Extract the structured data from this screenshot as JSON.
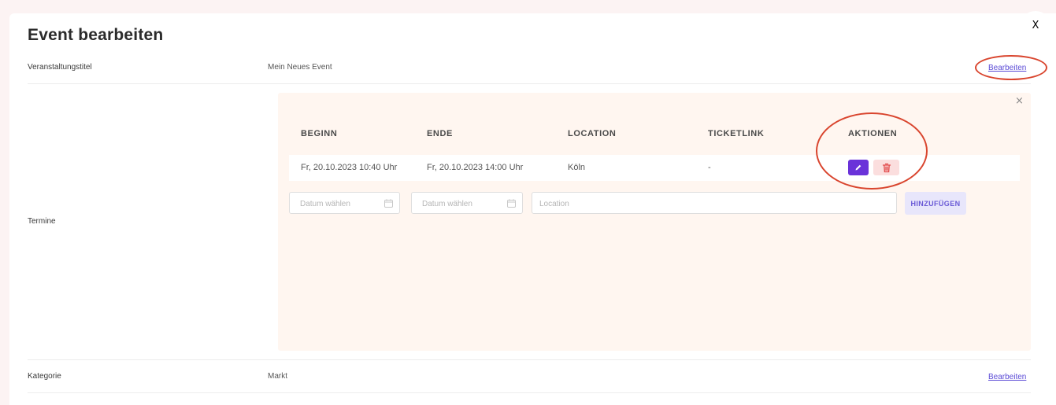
{
  "modal": {
    "title": "Event bearbeiten",
    "close_label": "X"
  },
  "fields": {
    "title": {
      "label": "Veranstaltungstitel",
      "value": "Mein Neues Event",
      "edit_label": "Bearbeiten"
    },
    "dates": {
      "label": "Termine"
    },
    "category": {
      "label": "Kategorie",
      "value": "Markt",
      "edit_label": "Bearbeiten"
    }
  },
  "dates_table": {
    "close_label": "×",
    "columns": [
      "BEGINN",
      "ENDE",
      "LOCATION",
      "TICKETLINK",
      "AKTIONEN"
    ],
    "rows": [
      {
        "start": "Fr, 20.10.2023 10:40 Uhr",
        "end": "Fr, 20.10.2023 14:00 Uhr",
        "location": "Köln",
        "ticketlink": "-"
      }
    ],
    "row_actions": [
      "pencil-icon",
      "trash-icon"
    ]
  },
  "new_date_form": {
    "start_placeholder": "Datum wählen",
    "end_placeholder": "Datum wählen",
    "location_placeholder": "Location",
    "add_label": "HINZUFÜGEN"
  },
  "colors": {
    "accent": "#6a32d9",
    "link": "#5b4bd6",
    "panel_bg": "#fff6f0",
    "delete_bg": "#fbdede",
    "annotation": "#d9452e"
  }
}
